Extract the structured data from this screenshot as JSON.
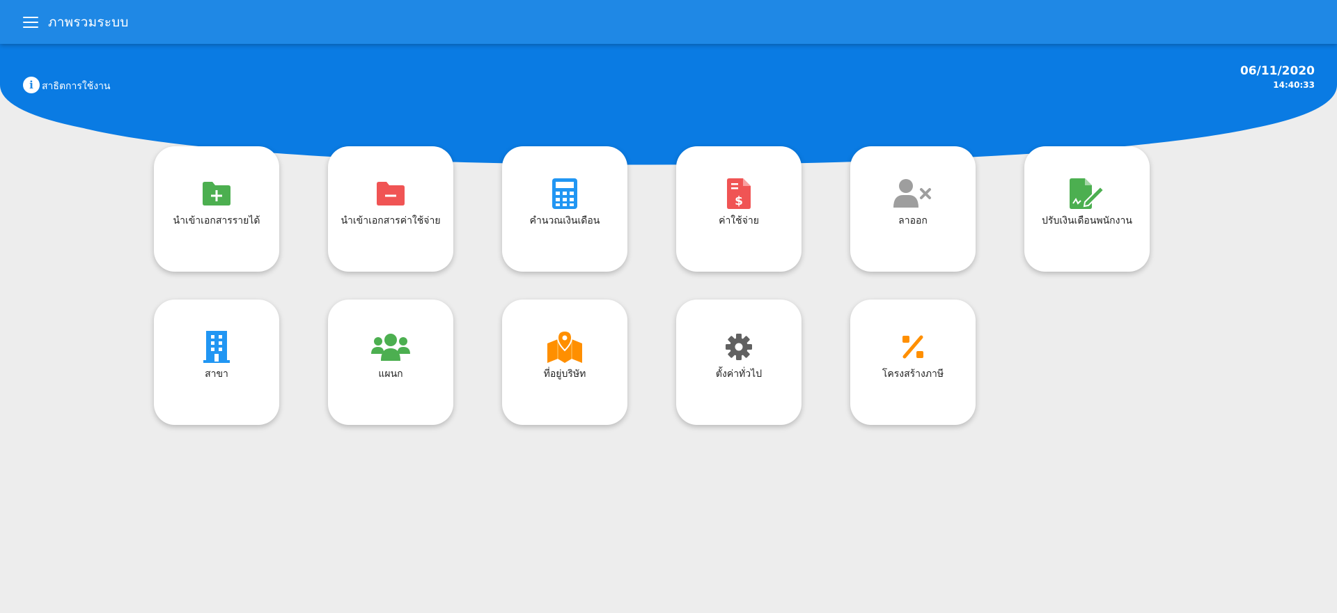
{
  "header": {
    "title": "ภาพรวมระบบ"
  },
  "info": {
    "label": "สาธิตการใช้งาน"
  },
  "datetime": {
    "date": "06/11/2020",
    "time": "14:40:33"
  },
  "tiles": [
    {
      "label": "นำเข้าเอกสารรายได้",
      "icon": "folder-plus-icon",
      "color": "#4caf50"
    },
    {
      "label": "นำเข้าเอกสารค่าใช้จ่าย",
      "icon": "folder-minus-icon",
      "color": "#f05454"
    },
    {
      "label": "คำนวณเงินเดือน",
      "icon": "calculator-icon",
      "color": "#2196f3"
    },
    {
      "label": "ค่าใช้จ่าย",
      "icon": "invoice-dollar-icon",
      "color": "#f05454"
    },
    {
      "label": "ลาออก",
      "icon": "user-remove-icon",
      "color": "#9e9e9e"
    },
    {
      "label": "ปรับเงินเดือนพนักงาน",
      "icon": "document-sign-icon",
      "color": "#4caf50"
    },
    {
      "label": "สาขา",
      "icon": "building-icon",
      "color": "#2196f3"
    },
    {
      "label": "แผนก",
      "icon": "users-group-icon",
      "color": "#4caf50"
    },
    {
      "label": "ที่อยู่บริษัท",
      "icon": "map-marker-icon",
      "color": "#ff8f00"
    },
    {
      "label": "ตั้งค่าทั่วไป",
      "icon": "gear-icon",
      "color": "#616161"
    },
    {
      "label": "โครงสร้างภาษี",
      "icon": "percent-icon",
      "color": "#ff8f00"
    }
  ],
  "colors": {
    "primary": "#1f88e5",
    "hero": "#0a7be3",
    "background": "#ededed"
  }
}
